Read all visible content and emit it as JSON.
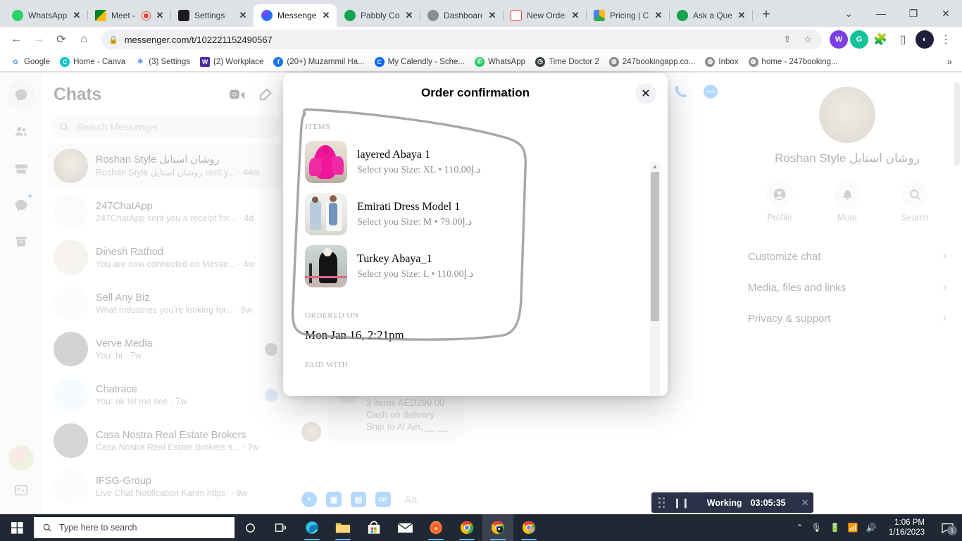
{
  "browser": {
    "tabs": [
      {
        "label": "WhatsApp",
        "favicon": "whatsapp-icon",
        "color": "#25D366",
        "active": false
      },
      {
        "label": "Meet -",
        "favicon": "google-meet-icon",
        "color": "#00832d",
        "active": false,
        "recording": true
      },
      {
        "label": "Settings",
        "favicon": "settings-icon",
        "color": "#2b2b2b",
        "active": false
      },
      {
        "label": "Messenger",
        "favicon": "messenger-icon",
        "color": "#0084ff",
        "active": true
      },
      {
        "label": "Pabbly Con",
        "favicon": "pabbly-icon",
        "color": "#14a44d",
        "active": false
      },
      {
        "label": "Dashboard",
        "favicon": "globe-icon",
        "color": "#8a8d91",
        "active": false
      },
      {
        "label": "New Order",
        "favicon": "gmail-icon",
        "color": "#ea4335",
        "active": false
      },
      {
        "label": "Pricing | C",
        "favicon": "drive-icon",
        "color": "#fbbc04",
        "active": false
      },
      {
        "label": "Ask a Ques",
        "favicon": "pabbly-icon",
        "color": "#14a44d",
        "active": false
      }
    ],
    "newtab_label": "+",
    "window_controls": {
      "list": "⌄",
      "minimize": "—",
      "maximize": "❐",
      "close": "✕"
    },
    "nav": {
      "back": "←",
      "forward": "→",
      "reload": "⟳",
      "home": "⌂"
    },
    "omnibox": {
      "url": "messenger.com/t/102221152490567",
      "lock": "🔒",
      "share": "share-icon",
      "star": "☆"
    },
    "bookmarks": [
      {
        "label": "Google",
        "icon": "G",
        "color": "#ffffff",
        "text_color": "#4285f4"
      },
      {
        "label": "Home - Canva",
        "icon": "C",
        "color": "#00c4cc",
        "text_color": "#ffffff"
      },
      {
        "label": "(3) Settings",
        "icon": "⚘",
        "color": "#ffffff",
        "text_color": "#5b8def"
      },
      {
        "label": "(2) Workplace",
        "icon": "W",
        "color": "#4b2ea8",
        "text_color": "#ffffff"
      },
      {
        "label": "(20+) Muzammil Ha...",
        "icon": "f",
        "color": "#1877f2",
        "text_color": "#ffffff"
      },
      {
        "label": "My Calendly - Sche...",
        "icon": "C",
        "color": "#006bff",
        "text_color": "#ffffff"
      },
      {
        "label": "WhatsApp",
        "icon": "✆",
        "color": "#25D366",
        "text_color": "#ffffff"
      },
      {
        "label": "Time Doctor 2",
        "icon": "◷",
        "color": "#3c4043",
        "text_color": "#ffffff"
      },
      {
        "label": "247bookingapp.co...",
        "icon": "◍",
        "color": "#8a8d91",
        "text_color": "#ffffff"
      },
      {
        "label": "Inbox",
        "icon": "◍",
        "color": "#8a8d91",
        "text_color": "#ffffff"
      },
      {
        "label": "home - 247booking...",
        "icon": "◍",
        "color": "#8a8d91",
        "text_color": "#ffffff"
      }
    ],
    "bookmarks_overflow": "»"
  },
  "messenger": {
    "rail": {
      "items": [
        "chats-icon",
        "people-icon",
        "marketplace-icon",
        "message-requests-icon",
        "archived-icon"
      ]
    },
    "chats_header": {
      "title": "Chats",
      "video_button": "new-video-call-icon",
      "compose_button": "new-message-icon"
    },
    "search": {
      "placeholder": "Search Messenger",
      "icon": "search-icon"
    },
    "chat_list": [
      {
        "name": "Roshan Style روشان استايل",
        "preview": "Roshan Style روشان استايل sent y...",
        "time": "44m",
        "selected": true
      },
      {
        "name": "247ChatApp",
        "preview": "247ChatApp sent you a receipt for...",
        "time": "4d",
        "selected": false
      },
      {
        "name": "Dinesh Rathod",
        "preview": "You are now connected on Messe...",
        "time": "4w",
        "selected": false
      },
      {
        "name": "Sell Any Biz",
        "preview": "What Industries you're looking for...",
        "time": "6w",
        "selected": false
      },
      {
        "name": "Verve Media",
        "preview": "You: hi",
        "time": "7w",
        "selected": false
      },
      {
        "name": "Chatrace",
        "preview": "You: ok let me see",
        "time": "7w",
        "selected": false
      },
      {
        "name": "Casa Nostra Real Estate Brokers",
        "preview": "Casa Nostra Real Estate Brokers s...",
        "time": "7w",
        "selected": false
      },
      {
        "name": "IFSG-Group",
        "preview": "Live Chat Notification Karim https:",
        "time": "9w",
        "selected": false
      }
    ],
    "thread_header_icons": [
      "phone-icon",
      "video-icon",
      "info-icon"
    ],
    "message": {
      "title": "Order confirmation",
      "line1": "3 items AED299.00",
      "line2": "Cash on delivery",
      "line3": "Ship to Al Ain, __ __",
      "check": "✓"
    },
    "composer": {
      "placeholder": "Aa",
      "buttons": [
        "plus-icon",
        "photo-icon",
        "sticker-icon",
        "gif-icon"
      ],
      "right_buttons": [
        "emoji-icon",
        "like-icon"
      ]
    },
    "right_panel": {
      "name": "Roshan Style روشان استايل",
      "actions": [
        {
          "label": "Profile",
          "icon": "profile-icon"
        },
        {
          "label": "Mute",
          "icon": "bell-icon"
        },
        {
          "label": "Search",
          "icon": "search-icon"
        }
      ],
      "sections": [
        {
          "label": "Customize chat",
          "chevron": "›"
        },
        {
          "label": "Media, files and links",
          "chevron": "›"
        },
        {
          "label": "Privacy & support",
          "chevron": "›"
        }
      ]
    }
  },
  "modal": {
    "title": "Order confirmation",
    "close_icon": "✕",
    "items_label": "ITEMS",
    "items": [
      {
        "name": "layered Abaya 1",
        "desc": "Select you Size: XL • 110.00د.إ",
        "thumb": "pink-abaya-photo"
      },
      {
        "name": "Emirati Dress Model 1",
        "desc": "Select you Size: M • 79.00د.إ",
        "thumb": "emirati-dress-photo"
      },
      {
        "name": "Turkey Abaya_1",
        "desc": "Select you Size: L • 110.00د.إ",
        "thumb": "black-abaya-photo"
      }
    ],
    "ordered_on_label": "ORDERED ON",
    "ordered_on_value": "Mon Jan 16, 2:21pm",
    "paid_with_label": "PAID WITH",
    "scroll_up": "▲",
    "scroll_down": "▼"
  },
  "time_doctor": {
    "status": "Working",
    "elapsed": "03:05:35",
    "pause_icon": "pause-icon",
    "close_icon": "✕",
    "dot_color": "#27c93f"
  },
  "taskbar": {
    "start": "windows-icon",
    "search_placeholder": "Type here to search",
    "search_icon": "search-icon",
    "buttons": [
      "cortana-icon",
      "task-view-icon"
    ],
    "apps": [
      "edge-icon",
      "file-explorer-icon",
      "microsoft-store-icon",
      "mail-icon",
      "firefox-icon",
      "chrome-icon",
      "chrome-icon",
      "chrome-icon"
    ],
    "tray_icons": [
      "chevron-up-icon",
      "microphone-icon",
      "battery-icon",
      "wifi-icon",
      "volume-icon"
    ],
    "time": "1:06 PM",
    "date": "1/16/2023",
    "notification_count": "1"
  }
}
